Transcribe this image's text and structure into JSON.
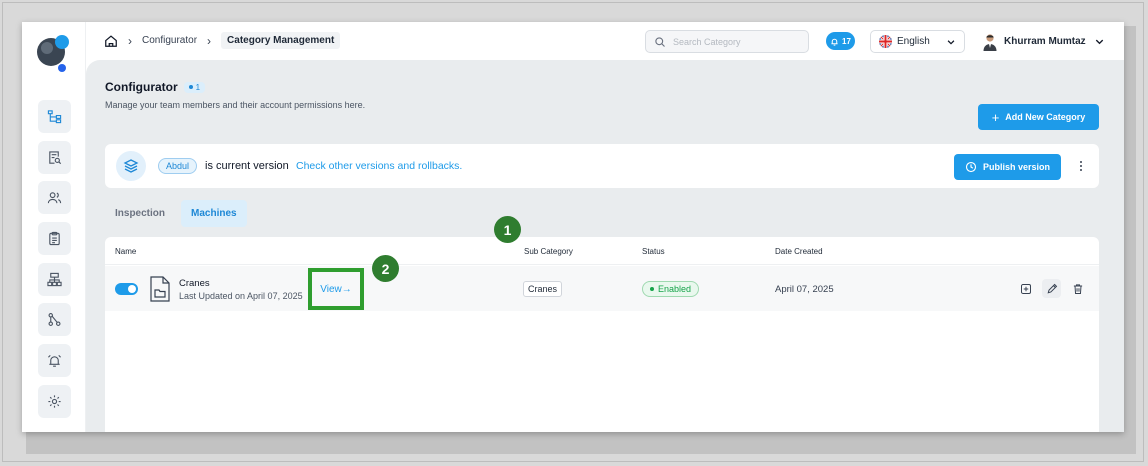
{
  "breadcrumbs": [
    "Configurator",
    "Category Management"
  ],
  "search": {
    "placeholder": "Search Category"
  },
  "notifications": {
    "count": "17"
  },
  "language": {
    "selected": "English"
  },
  "user": {
    "name": "Khurram Mumtaz"
  },
  "sidebar": {
    "items": [
      {
        "icon": "hierarchy-icon"
      },
      {
        "icon": "document-search-icon"
      },
      {
        "icon": "users-icon"
      },
      {
        "icon": "clipboard-icon"
      },
      {
        "icon": "sitemap-icon"
      },
      {
        "icon": "branch-icon"
      },
      {
        "icon": "alarm-icon"
      },
      {
        "icon": "gear-icon"
      }
    ]
  },
  "page": {
    "title": "Configurator",
    "badge": "1",
    "subtitle": "Manage your team members and their account permissions here.",
    "add_button": "Add New Category"
  },
  "version": {
    "tag": "Abdul",
    "text": "is current version",
    "link": "Check other versions and rollbacks.",
    "publish_button": "Publish version"
  },
  "tabs": [
    {
      "label": "Inspection",
      "active": false
    },
    {
      "label": "Machines",
      "active": true
    }
  ],
  "table": {
    "headers": {
      "name": "Name",
      "sub_category": "Sub Category",
      "status": "Status",
      "date_created": "Date Created"
    },
    "rows": [
      {
        "enabled": true,
        "name": "Cranes",
        "updated": "Last Updated on April 07, 2025",
        "view_label": "View",
        "sub_category": "Cranes",
        "status": "Enabled",
        "date_created": "April 07, 2025"
      }
    ]
  },
  "callouts": [
    "1",
    "2"
  ],
  "colors": {
    "accent": "#1e9be9",
    "success": "#16a34a",
    "callout": "#2f7d2f"
  }
}
